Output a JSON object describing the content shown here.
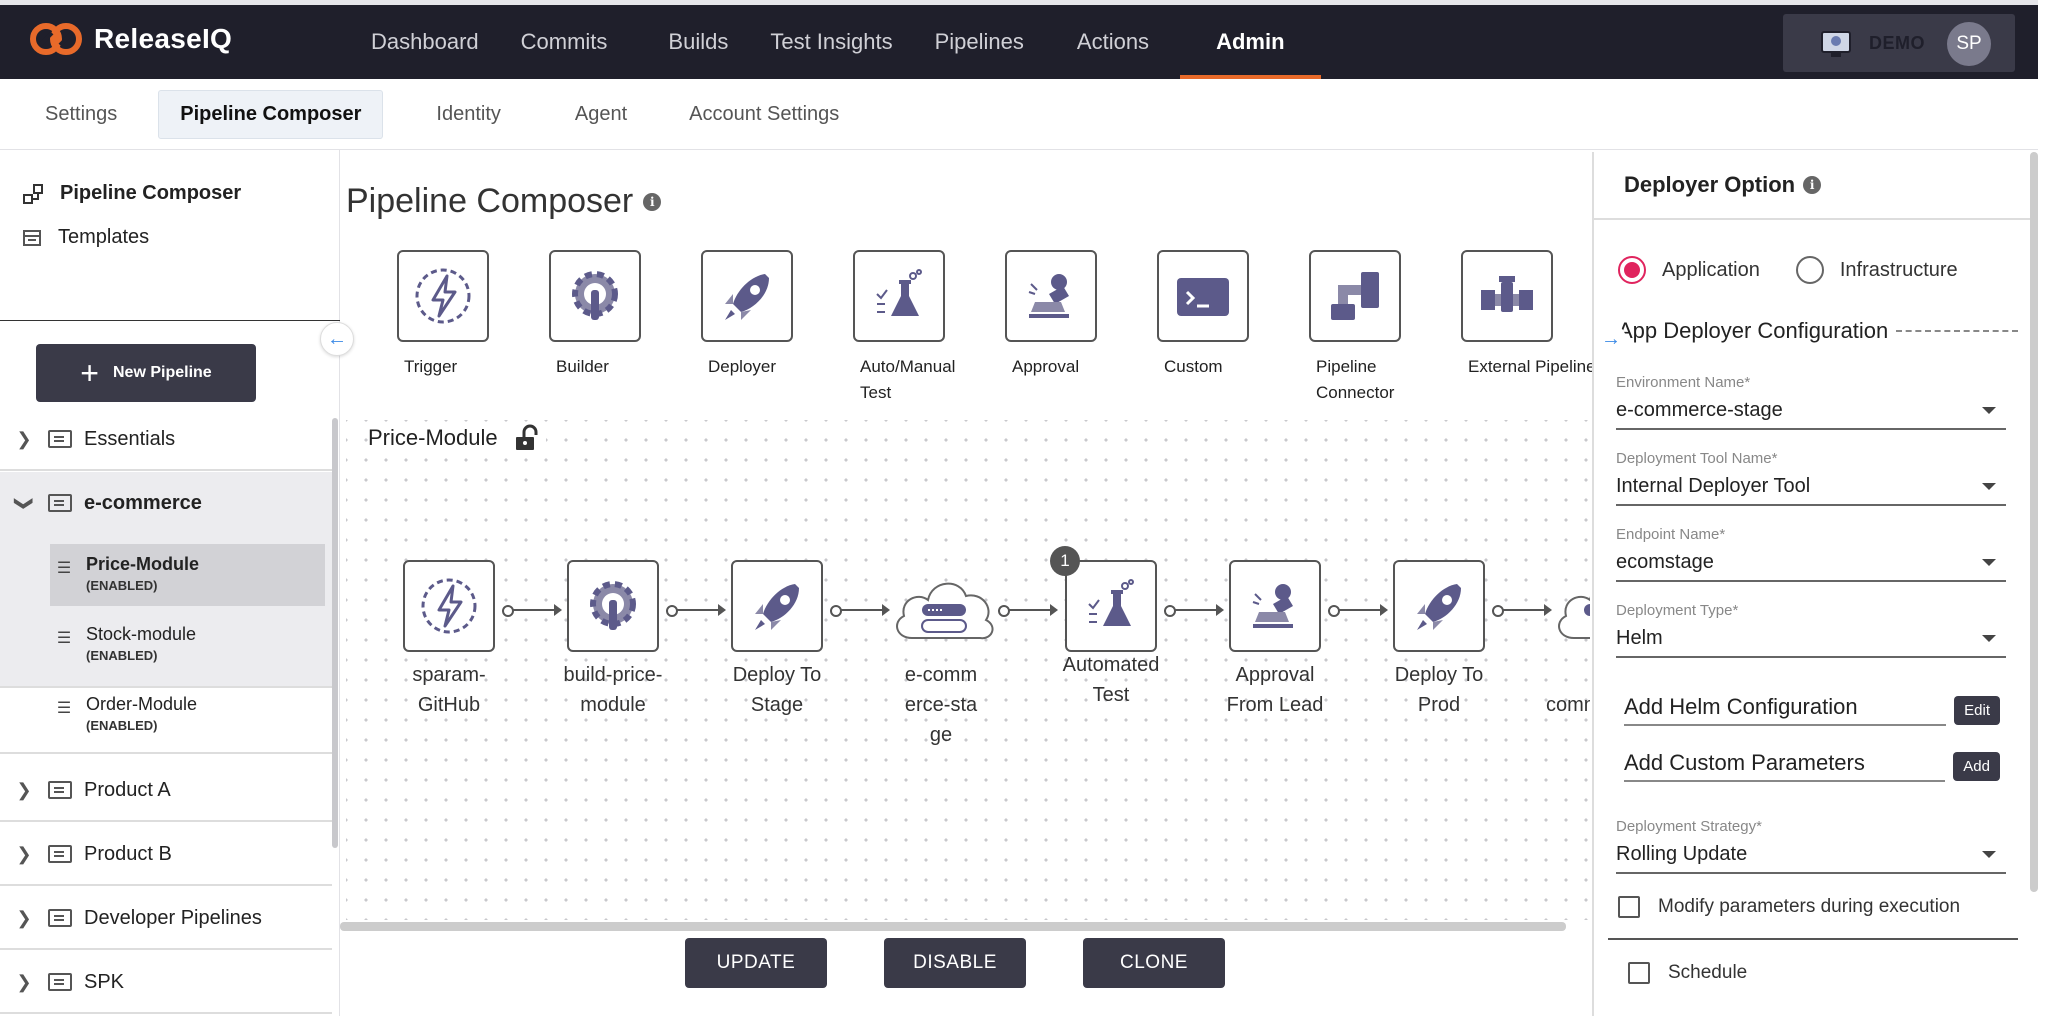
{
  "app": {
    "name": "ReleaseIQ"
  },
  "nav": {
    "items": [
      "Dashboard",
      "Commits",
      "Builds",
      "Test Insights",
      "Pipelines",
      "Actions",
      "Admin"
    ],
    "active": "Admin",
    "demo_label": "DEMO",
    "avatar_initials": "SP"
  },
  "subnav": {
    "tabs": [
      "Settings",
      "Pipeline Composer",
      "Identity",
      "Agent",
      "Account Settings"
    ],
    "active": "Pipeline Composer"
  },
  "sidebar": {
    "links": [
      "Pipeline Composer",
      "Templates"
    ],
    "new_pipeline_label": "New Pipeline",
    "groups": [
      {
        "name": "Essentials",
        "open": false
      },
      {
        "name": "e-commerce",
        "open": true,
        "children": [
          {
            "name": "Price-Module",
            "status": "(ENABLED)",
            "selected": true
          },
          {
            "name": "Stock-module",
            "status": "(ENABLED)",
            "selected": false
          },
          {
            "name": "Order-Module",
            "status": "(ENABLED)",
            "selected": false
          }
        ]
      },
      {
        "name": "Product A",
        "open": false
      },
      {
        "name": "Product B",
        "open": false
      },
      {
        "name": "Developer Pipelines",
        "open": false
      },
      {
        "name": "SPK",
        "open": false
      }
    ]
  },
  "main": {
    "title": "Pipeline Composer",
    "palette": [
      {
        "label": "Trigger",
        "icon": "trigger-icon"
      },
      {
        "label": "Builder",
        "icon": "builder-icon"
      },
      {
        "label": "Deployer",
        "icon": "deployer-icon"
      },
      {
        "label": "Auto/Manual Test",
        "icon": "test-icon"
      },
      {
        "label": "Approval",
        "icon": "approval-icon"
      },
      {
        "label": "Custom",
        "icon": "custom-icon"
      },
      {
        "label": "Pipeline Connector",
        "icon": "connector-icon"
      },
      {
        "label": "External Pipeline",
        "icon": "external-pipeline-icon"
      }
    ],
    "pipeline_name": "Price-Module",
    "nodes": [
      {
        "label": "sparam-GitHub",
        "icon": "trigger-icon"
      },
      {
        "label": "build-price-module",
        "icon": "builder-icon"
      },
      {
        "label": "Deploy To Stage",
        "icon": "deployer-icon"
      },
      {
        "label": "e-commerce-stage",
        "icon": "cloud-icon"
      },
      {
        "label": "Automated Test",
        "icon": "test-icon",
        "badge": "1"
      },
      {
        "label": "Approval From Lead",
        "icon": "approval-icon"
      },
      {
        "label": "Deploy To Prod",
        "icon": "deployer-icon"
      },
      {
        "label": "commerce-p",
        "icon": "cloud-icon"
      }
    ],
    "actions": [
      "UPDATE",
      "DISABLE",
      "CLONE"
    ]
  },
  "panel": {
    "title": "Deployer Option",
    "radio_options": [
      "Application",
      "Infrastructure"
    ],
    "radio_selected": "Application",
    "section_title": "App Deployer Configuration",
    "fields": [
      {
        "label": "Environment Name*",
        "value": "e-commerce-stage"
      },
      {
        "label": "Deployment Tool Name*",
        "value": "Internal Deployer Tool"
      },
      {
        "label": "Endpoint Name*",
        "value": "ecomstage"
      },
      {
        "label": "Deployment Type*",
        "value": "Helm"
      }
    ],
    "helm_config": {
      "label": "Add Helm Configuration",
      "button": "Edit"
    },
    "custom_params": {
      "label": "Add Custom Parameters",
      "button": "Add"
    },
    "strategy": {
      "label": "Deployment Strategy*",
      "value": "Rolling Update"
    },
    "modify_label": "Modify parameters during execution",
    "schedule_label": "Schedule"
  },
  "colors": {
    "topbar": "#1f1f2b",
    "accent": "#e86a2a",
    "primary_button": "#3a3a48",
    "radio_selected": "#e0245e",
    "link": "#3b8ae6"
  }
}
